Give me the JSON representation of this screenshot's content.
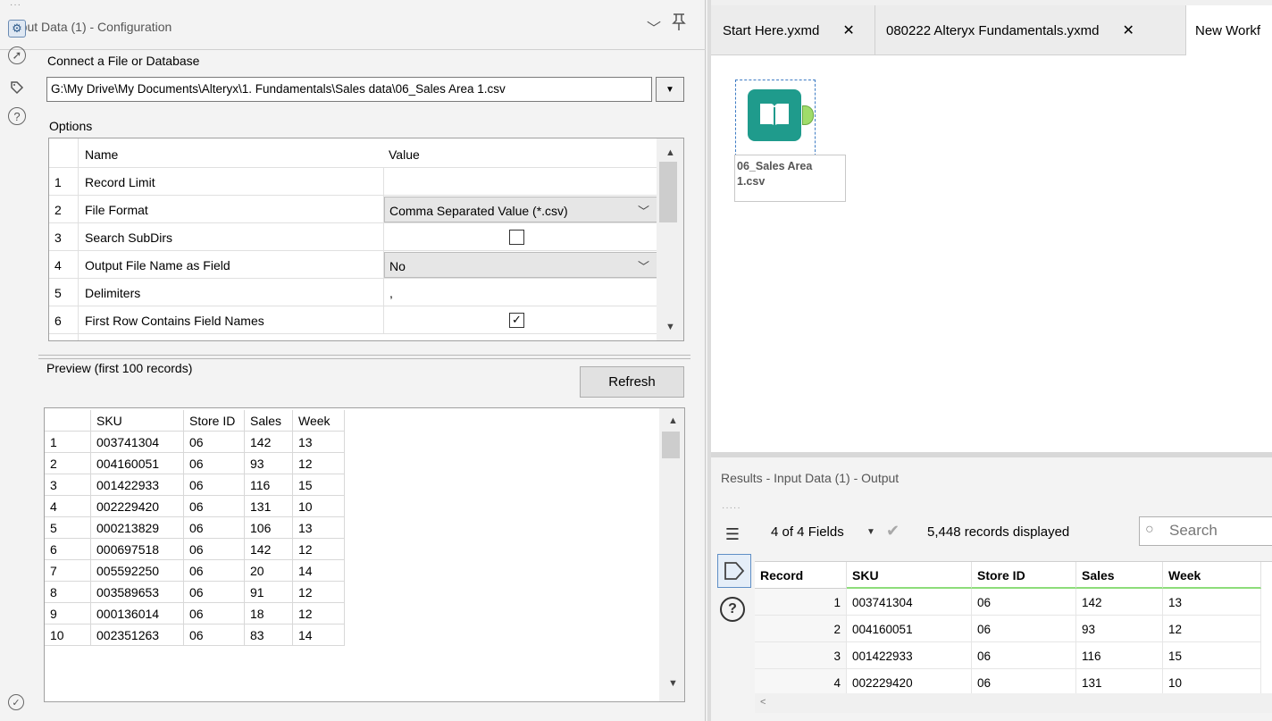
{
  "config": {
    "title": "Input Data (1) - Configuration",
    "connect_label": "Connect a File or Database",
    "file_path": "G:\\My Drive\\My Documents\\Alteryx\\1. Fundamentals\\Sales data\\06_Sales Area 1.csv",
    "options_label": "Options",
    "options_headers": {
      "name": "Name",
      "value": "Value"
    },
    "options": [
      {
        "num": "1",
        "name": "Record Limit",
        "value": ""
      },
      {
        "num": "2",
        "name": "File Format",
        "value": "Comma Separated Value (*.csv)"
      },
      {
        "num": "3",
        "name": "Search SubDirs",
        "checked": false
      },
      {
        "num": "4",
        "name": "Output File Name as Field",
        "value": "No"
      },
      {
        "num": "5",
        "name": "Delimiters",
        "value": ","
      },
      {
        "num": "6",
        "name": "First Row Contains Field Names",
        "checked": true
      }
    ],
    "preview_label": "Preview (first 100 records)",
    "refresh_label": "Refresh",
    "preview_headers": [
      "",
      "SKU",
      "Store ID",
      "Sales",
      "Week"
    ],
    "preview_rows": [
      [
        "1",
        "003741304",
        "06",
        "142",
        "13"
      ],
      [
        "2",
        "004160051",
        "06",
        "93",
        "12"
      ],
      [
        "3",
        "001422933",
        "06",
        "116",
        "15"
      ],
      [
        "4",
        "002229420",
        "06",
        "131",
        "10"
      ],
      [
        "5",
        "000213829",
        "06",
        "106",
        "13"
      ],
      [
        "6",
        "000697518",
        "06",
        "142",
        "12"
      ],
      [
        "7",
        "005592250",
        "06",
        "20",
        "14"
      ],
      [
        "8",
        "003589653",
        "06",
        "91",
        "12"
      ],
      [
        "9",
        "000136014",
        "06",
        "18",
        "12"
      ],
      [
        "10",
        "002351263",
        "06",
        "83",
        "14"
      ]
    ]
  },
  "tabs": [
    {
      "label": "Start Here.yxmd",
      "close": "✕"
    },
    {
      "label": "080222 Alteryx Fundamentals.yxmd",
      "close": "✕"
    },
    {
      "label": "New Workf"
    }
  ],
  "canvas": {
    "tool_caption": "06_Sales Area 1.csv"
  },
  "results": {
    "title": "Results - Input Data (1) - Output",
    "fields_count": "4 of 4 Fields",
    "records_label": "5,448 records displayed",
    "search_placeholder": "Search",
    "headers": [
      "Record",
      "SKU",
      "Store ID",
      "Sales",
      "Week"
    ],
    "rows": [
      [
        "1",
        "003741304",
        "06",
        "142",
        "13"
      ],
      [
        "2",
        "004160051",
        "06",
        "93",
        "12"
      ],
      [
        "3",
        "001422933",
        "06",
        "116",
        "15"
      ],
      [
        "4",
        "002229420",
        "06",
        "131",
        "10"
      ]
    ]
  },
  "colors": {
    "tool_teal": "#1f9b8c",
    "anchor_green": "#9fdc6a",
    "field_underline": "#8ddc7a",
    "selection_blue": "#3e7cc4"
  },
  "icons": [
    "gear-icon",
    "navigate-icon",
    "tag-icon",
    "help-icon",
    "pin-icon",
    "chevron-down-icon",
    "close-icon",
    "search-icon",
    "list-icon",
    "check-icon",
    "book-icon"
  ]
}
